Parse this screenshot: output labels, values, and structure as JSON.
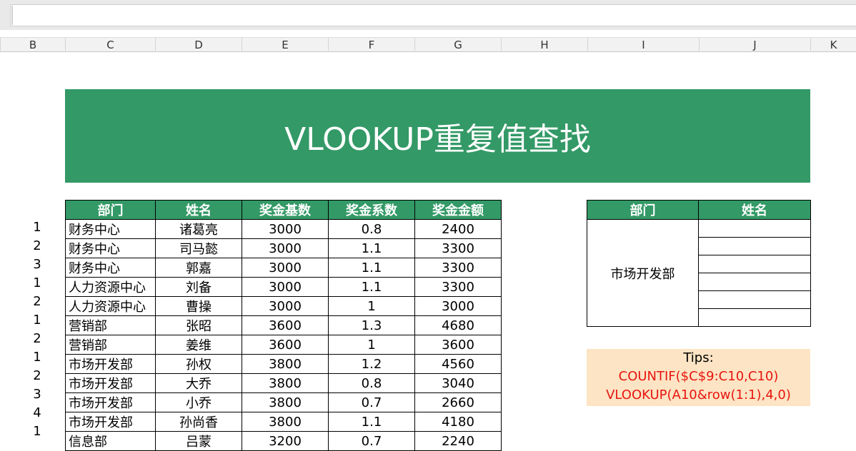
{
  "sheet": {
    "columns": [
      "B",
      "C",
      "D",
      "E",
      "F",
      "G",
      "H",
      "I",
      "J",
      "K"
    ],
    "title": "VLOOKUP重复值查找",
    "main_table": {
      "headers": [
        "部门",
        "姓名",
        "奖金基数",
        "奖金系数",
        "奖金金额"
      ],
      "rows": [
        {
          "idx": "1",
          "dept": "财务中心",
          "name": "诸葛亮",
          "base": "3000",
          "coef": "0.8",
          "amount": "2400"
        },
        {
          "idx": "2",
          "dept": "财务中心",
          "name": "司马懿",
          "base": "3000",
          "coef": "1.1",
          "amount": "3300"
        },
        {
          "idx": "3",
          "dept": "财务中心",
          "name": "郭嘉",
          "base": "3000",
          "coef": "1.1",
          "amount": "3300"
        },
        {
          "idx": "1",
          "dept": "人力资源中心",
          "name": "刘备",
          "base": "3000",
          "coef": "1.1",
          "amount": "3300"
        },
        {
          "idx": "2",
          "dept": "人力资源中心",
          "name": "曹操",
          "base": "3000",
          "coef": "1",
          "amount": "3000"
        },
        {
          "idx": "1",
          "dept": "营销部",
          "name": "张昭",
          "base": "3600",
          "coef": "1.3",
          "amount": "4680"
        },
        {
          "idx": "2",
          "dept": "营销部",
          "name": "姜维",
          "base": "3600",
          "coef": "1",
          "amount": "3600"
        },
        {
          "idx": "1",
          "dept": "市场开发部",
          "name": "孙权",
          "base": "3800",
          "coef": "1.2",
          "amount": "4560"
        },
        {
          "idx": "2",
          "dept": "市场开发部",
          "name": "大乔",
          "base": "3800",
          "coef": "0.8",
          "amount": "3040"
        },
        {
          "idx": "3",
          "dept": "市场开发部",
          "name": "小乔",
          "base": "3800",
          "coef": "0.7",
          "amount": "2660"
        },
        {
          "idx": "4",
          "dept": "市场开发部",
          "name": "孙尚香",
          "base": "3800",
          "coef": "1.1",
          "amount": "4180"
        },
        {
          "idx": "1",
          "dept": "信息部",
          "name": "吕蒙",
          "base": "3200",
          "coef": "0.7",
          "amount": "2240"
        }
      ]
    },
    "lookup_table": {
      "headers": [
        "部门",
        "姓名"
      ],
      "dept_value": "市场开发部",
      "names": [
        "",
        "",
        "",
        "",
        "",
        ""
      ]
    },
    "tips": {
      "line1": "Tips:",
      "line2": "COUNTIF($C$9:C10,C10)",
      "line3": "VLOOKUP(A10&row(1:1),4,0)"
    },
    "colors": {
      "header_green": "#339966",
      "tips_bg": "#fce4c4",
      "tips_red": "#e8150f"
    }
  }
}
